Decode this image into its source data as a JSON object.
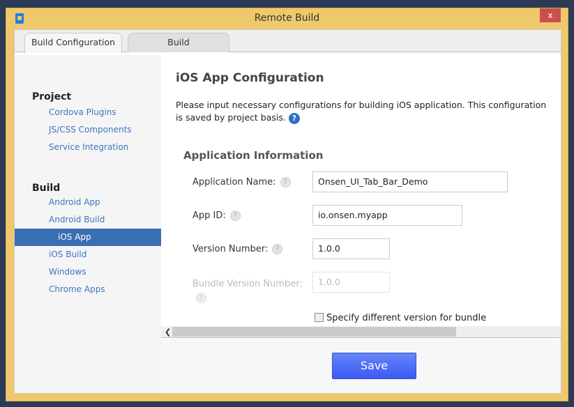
{
  "window": {
    "title": "Remote Build",
    "close": "x"
  },
  "tabs": [
    {
      "label": "Build Configuration"
    },
    {
      "label": "Build"
    }
  ],
  "sidebar": {
    "sections": [
      {
        "title": "Project",
        "items": [
          "Cordova Plugins",
          "JS/CSS Components",
          "Service Integration"
        ]
      },
      {
        "title": "Build",
        "items": [
          "Android App",
          "Android Build",
          "iOS App",
          "iOS Build",
          "Windows",
          "Chrome Apps"
        ]
      }
    ],
    "active": "iOS App"
  },
  "main": {
    "title": "iOS App Configuration",
    "description": "Please input necessary configurations for building iOS application. This configuration is saved by project basis.",
    "section": "Application Information",
    "fields": [
      {
        "label": "Application Name:",
        "value": "Onsen_UI_Tab_Bar_Demo"
      },
      {
        "label": "App ID:",
        "value": "io.onsen.myapp"
      },
      {
        "label": "Version Number:",
        "value": "1.0.0"
      },
      {
        "label": "Bundle Version Number:",
        "value": "1.0.0"
      }
    ],
    "checkbox": "Specify different version for bundle",
    "help": "?"
  },
  "footer": {
    "save": "Save"
  }
}
